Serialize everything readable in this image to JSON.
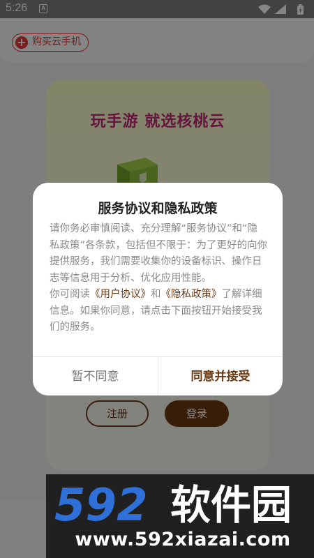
{
  "status_bar": {
    "time": "5:26",
    "notification_glyph": "A",
    "icons": [
      "wifi-icon",
      "signal-icon",
      "battery-charging-icon"
    ]
  },
  "background": {
    "buy_button_label": "购买云手机",
    "slogan": "玩手游 就选核桃云",
    "register_label": "注册",
    "login_label": "登录"
  },
  "dialog": {
    "title": "服务协议和隐私政策",
    "paragraph1": "请你务必审慎阅读、充分理解“服务协议”和“隐私政策”各条款，包括但不限于：为了更好的向你提供服务，我们需要收集你的设备标识、操作日志等信息用于分析、优化应用性能。",
    "p2_prefix": "你可阅读",
    "user_agreement_link": "《用户协议》",
    "p2_and": "和",
    "privacy_policy_link": "《隐私政策》",
    "p2_suffix": "了解详细信息。如果你同意，请点击下面按钮开始接受我们的服务。",
    "decline_label": "暂不同意",
    "accept_label": "同意并接受"
  },
  "watermark": {
    "logo_digits": "592",
    "logo_text": "软件园",
    "url": "www.592xiazai.com"
  },
  "colors": {
    "accent_brown": "#6b3a12",
    "buy_red": "#e83a3a",
    "slogan_pink": "#c22a78",
    "watermark_blue": "#2f6fd8"
  }
}
